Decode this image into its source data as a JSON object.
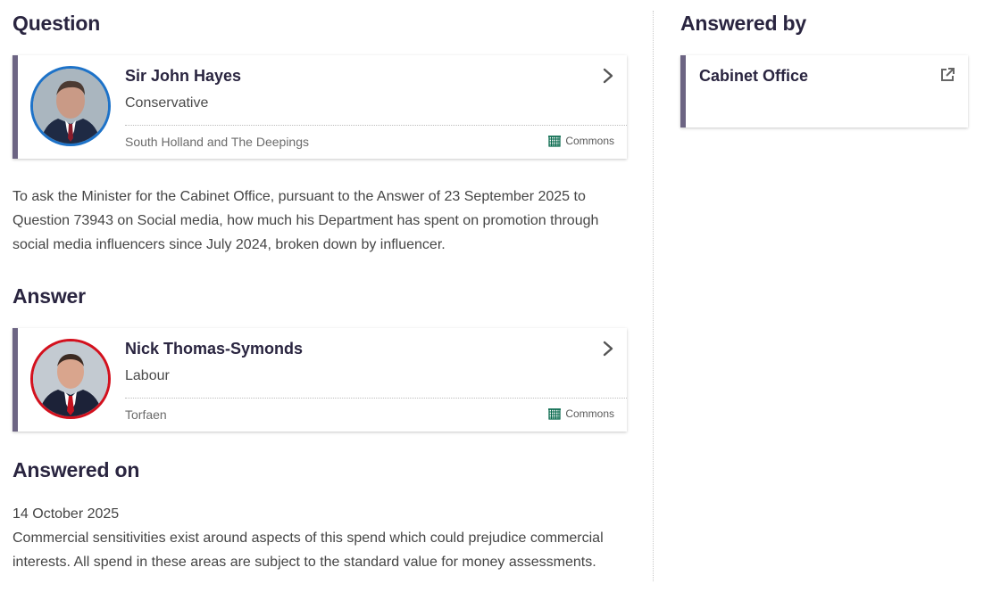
{
  "headings": {
    "question": "Question",
    "answer": "Answer",
    "answered_on": "Answered on",
    "answered_by": "Answered by"
  },
  "asker": {
    "name": "Sir John Hayes",
    "party": "Conservative",
    "constituency": "South Holland and The Deepings",
    "house": "Commons",
    "party_color": "#1d72c8",
    "icons": {
      "avatar": "member-portrait",
      "link": "chevron-right-icon",
      "house": "portcullis-icon"
    }
  },
  "question_text": "To ask the Minister for the Cabinet Office, pursuant to the Answer of 23 September 2025 to Question 73943 on Social media, how much his Department has spent on promotion through social media influencers since July 2024, broken down by influencer.",
  "answerer": {
    "name": "Nick Thomas-Symonds",
    "party": "Labour",
    "constituency": "Torfaen",
    "house": "Commons",
    "party_color": "#d3101d",
    "icons": {
      "avatar": "member-portrait",
      "link": "chevron-right-icon",
      "house": "portcullis-icon"
    }
  },
  "answered_on": {
    "date": "14 October 2025",
    "text": "Commercial sensitivities exist around aspects of this spend which could prejudice commercial interests. All spend in these areas are subject to the standard value for money assessments."
  },
  "answered_by": {
    "department": "Cabinet Office",
    "icon": "external-link-icon"
  },
  "colors": {
    "card_accent": "#6c6483",
    "heading": "#2a2540",
    "commons_green": "#006548"
  }
}
